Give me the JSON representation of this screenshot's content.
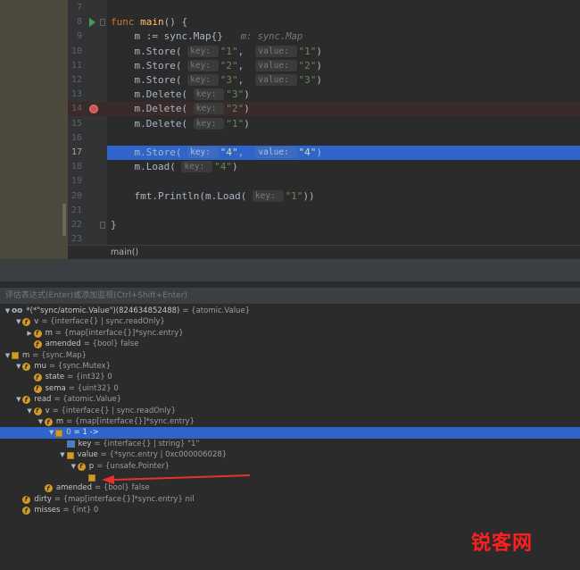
{
  "editor": {
    "lines": [
      {
        "num": "7",
        "tokens": []
      },
      {
        "num": "8",
        "tokens": [
          [
            "kw",
            "func "
          ],
          [
            "fn",
            "main"
          ],
          [
            "p",
            "() {"
          ]
        ],
        "gutter_icon": "run"
      },
      {
        "num": "9",
        "tokens": [
          [
            "p",
            "    m := sync.Map{}   "
          ],
          [
            "c",
            "m: sync.Map"
          ]
        ]
      },
      {
        "num": "10",
        "tokens": [
          [
            "p",
            "    m.Store( "
          ],
          [
            "h",
            "key: "
          ],
          [
            "s",
            "\"1\""
          ],
          [
            "p",
            ",  "
          ],
          [
            "h",
            "value: "
          ],
          [
            "s",
            "\"1\""
          ],
          [
            "p",
            ")"
          ]
        ]
      },
      {
        "num": "11",
        "tokens": [
          [
            "p",
            "    m.Store( "
          ],
          [
            "h",
            "key: "
          ],
          [
            "s",
            "\"2\""
          ],
          [
            "p",
            ",  "
          ],
          [
            "h",
            "value: "
          ],
          [
            "s",
            "\"2\""
          ],
          [
            "p",
            ")"
          ]
        ]
      },
      {
        "num": "12",
        "tokens": [
          [
            "p",
            "    m.Store( "
          ],
          [
            "h",
            "key: "
          ],
          [
            "s",
            "\"3\""
          ],
          [
            "p",
            ",  "
          ],
          [
            "h",
            "value: "
          ],
          [
            "s",
            "\"3\""
          ],
          [
            "p",
            ")"
          ]
        ]
      },
      {
        "num": "13",
        "tokens": [
          [
            "p",
            "    m.Delete( "
          ],
          [
            "h",
            "key: "
          ],
          [
            "s",
            "\"3\""
          ],
          [
            "p",
            ")"
          ]
        ]
      },
      {
        "num": "14",
        "tokens": [
          [
            "p",
            "    m.Delete( "
          ],
          [
            "h",
            "key: "
          ],
          [
            "s",
            "\"2\""
          ],
          [
            "p",
            ")"
          ]
        ],
        "gutter_icon": "breakpoint",
        "highlight": "red"
      },
      {
        "num": "15",
        "tokens": [
          [
            "p",
            "    m.Delete( "
          ],
          [
            "h",
            "key: "
          ],
          [
            "s",
            "\"1\""
          ],
          [
            "p",
            ")"
          ]
        ]
      },
      {
        "num": "16",
        "tokens": []
      },
      {
        "num": "17",
        "tokens": [
          [
            "p",
            "    m.Store( "
          ],
          [
            "h",
            "key: "
          ],
          [
            "s",
            "\"4\""
          ],
          [
            "p",
            ",  "
          ],
          [
            "h",
            "value: "
          ],
          [
            "s",
            "\"4\""
          ],
          [
            "p",
            ")"
          ]
        ],
        "highlight": "blue"
      },
      {
        "num": "18",
        "tokens": [
          [
            "p",
            "    m.Load( "
          ],
          [
            "h",
            "key: "
          ],
          [
            "s",
            "\"4\""
          ],
          [
            "p",
            ")"
          ]
        ]
      },
      {
        "num": "19",
        "tokens": []
      },
      {
        "num": "20",
        "tokens": [
          [
            "p",
            "    fmt.Println(m.Load( "
          ],
          [
            "h",
            "key: "
          ],
          [
            "s",
            "\"1\""
          ],
          [
            "p",
            "))"
          ]
        ]
      },
      {
        "num": "21",
        "tokens": []
      },
      {
        "num": "22",
        "tokens": [
          [
            "p",
            "}"
          ]
        ]
      },
      {
        "num": "23",
        "tokens": []
      }
    ],
    "breadcrumb": "main()"
  },
  "debugger": {
    "eval_placeholder": "评估表达式(Enter)或添加监视(Ctrl+Shift+Enter)",
    "rows": [
      {
        "indent": 0,
        "arrow": "down",
        "icon": "oo",
        "name": "*(*\"sync/atomic.Value\")(824634852488)",
        "value": "= {atomic.Value}"
      },
      {
        "indent": 1,
        "arrow": "down",
        "icon": "f",
        "name": "v",
        "value": "= {interface{} | sync.readOnly}"
      },
      {
        "indent": 2,
        "arrow": "right",
        "icon": "f",
        "name": "m",
        "value": "= {map[interface{}]*sync.entry}"
      },
      {
        "indent": 2,
        "arrow": "",
        "icon": "f",
        "name": "amended",
        "value": "= {bool} false"
      },
      {
        "indent": 0,
        "arrow": "down",
        "icon": "list",
        "name": "m",
        "value": "= {sync.Map}"
      },
      {
        "indent": 1,
        "arrow": "down",
        "icon": "f",
        "name": "mu",
        "value": "= {sync.Mutex}"
      },
      {
        "indent": 2,
        "arrow": "",
        "icon": "f",
        "name": "state",
        "value": "= {int32} 0"
      },
      {
        "indent": 2,
        "arrow": "",
        "icon": "f",
        "name": "sema",
        "value": "= {uint32} 0"
      },
      {
        "indent": 1,
        "arrow": "down",
        "icon": "f",
        "name": "read",
        "value": "= {atomic.Value}"
      },
      {
        "indent": 2,
        "arrow": "down",
        "icon": "f",
        "name": "v",
        "value": "= {interface{} | sync.readOnly}"
      },
      {
        "indent": 3,
        "arrow": "down",
        "icon": "f",
        "name": "m",
        "value": "= {map[interface{}]*sync.entry}"
      },
      {
        "indent": 4,
        "arrow": "down",
        "icon": "list",
        "name": "0",
        "value": "= 1 ->",
        "selected": true
      },
      {
        "indent": 5,
        "arrow": "",
        "icon": "blue",
        "name": "key",
        "value": "= {interface{} | string} \"1\""
      },
      {
        "indent": 5,
        "arrow": "down",
        "icon": "list",
        "name": "value",
        "value": "= {*sync.entry | 0xc000006028}"
      },
      {
        "indent": 6,
        "arrow": "down",
        "icon": "f",
        "name": "p",
        "value": "= {unsafe.Pointer}"
      },
      {
        "indent": 7,
        "arrow": "",
        "icon": "list",
        "name": "",
        "value": ""
      },
      {
        "indent": 3,
        "arrow": "",
        "icon": "f",
        "name": "amended",
        "value": "= {bool} false"
      },
      {
        "indent": 1,
        "arrow": "",
        "icon": "f",
        "name": "dirty",
        "value": "= {map[interface{}]*sync.entry} nil"
      },
      {
        "indent": 1,
        "arrow": "",
        "icon": "f",
        "name": "misses",
        "value": "= {int} 0"
      }
    ]
  },
  "colors": {
    "annotation_arrow": "#e8312f",
    "selection": "#2f65ca",
    "breakpoint_line": "#3b2a2a"
  },
  "watermark": "锐客网"
}
